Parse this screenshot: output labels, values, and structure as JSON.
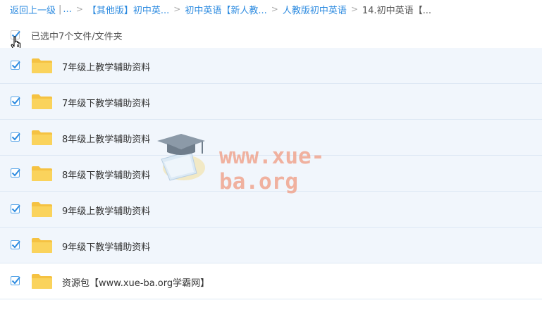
{
  "breadcrumb": {
    "back_label": "返回上一级",
    "back_suffix": "...",
    "items": [
      "【其他版】初中英...",
      "初中英语【新人教...",
      "人教版初中英语"
    ],
    "current": "14.初中英语【..."
  },
  "selection": {
    "label": "已选中7个文件/文件夹"
  },
  "files": [
    {
      "name": "7年级上教学辅助资料",
      "checked": true
    },
    {
      "name": "7年级下教学辅助资料",
      "checked": true
    },
    {
      "name": "8年级上教学辅助资料",
      "checked": true
    },
    {
      "name": "8年级下教学辅助资料",
      "checked": true
    },
    {
      "name": "9年级上教学辅助资料",
      "checked": true
    },
    {
      "name": "9年级下教学辅助资料",
      "checked": true
    },
    {
      "name": "资源包【www.xue-ba.org学霸网】",
      "checked": true
    }
  ],
  "watermark": {
    "text": "www.xue-ba.org"
  },
  "colors": {
    "link": "#2d8be0",
    "row_selected_bg": "#f1f6fc",
    "check": "#2d8be0",
    "folder": "#f7c948"
  }
}
